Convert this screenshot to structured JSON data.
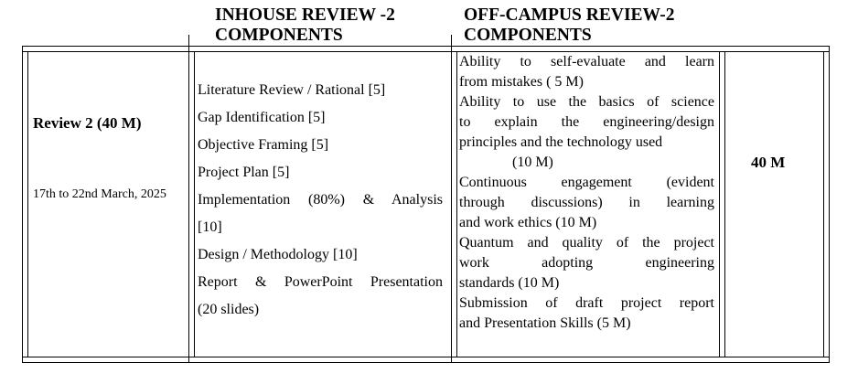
{
  "headers": {
    "inhouse_line1": "INHOUSE REVIEW -2",
    "inhouse_line2": "COMPONENTS",
    "offcampus_line1": "OFF-CAMPUS REVIEW-2",
    "offcampus_line2": "COMPONENTS"
  },
  "review": {
    "title": "Review 2  (40 M)",
    "dates": "17th to 22nd March, 2025"
  },
  "inhouse_lines": [
    "Literature Review / Rational [5]",
    "Gap Identification [5]",
    "Objective Framing [5]",
    "Project Plan [5]",
    "Implementation (80%) & Analysis",
    "[10]",
    "Design / Methodology [10]",
    "Report & PowerPoint Presentation",
    "(20 slides)"
  ],
  "offcampus_lines": [
    "Ability to self-evaluate and learn",
    "from mistakes ( 5 M)",
    "Ability to use the basics of science",
    "to explain the engineering/design",
    "principles and the technology used",
    "(10 M)",
    "Continuous engagement (evident",
    "through discussions) in learning",
    "and work ethics (10 M)",
    "Quantum and quality of the project",
    "work adopting engineering",
    "standards (10 M)",
    "Submission of draft project report",
    "and Presentation Skills (5 M)"
  ],
  "total": "40 M"
}
